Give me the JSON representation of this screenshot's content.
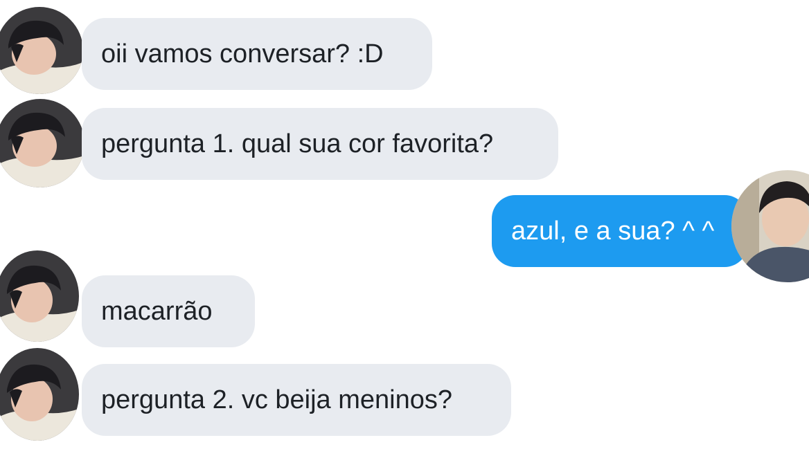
{
  "conversation": {
    "messages": [
      {
        "sender": "other",
        "text": "oii vamos conversar? :D"
      },
      {
        "sender": "other",
        "text": "pergunta 1. qual sua cor favorita?"
      },
      {
        "sender": "me",
        "text": "azul, e a sua? ^ ^"
      },
      {
        "sender": "other",
        "text": "macarrão"
      },
      {
        "sender": "other",
        "text": "pergunta 2. vc beija meninos?"
      }
    ]
  },
  "colors": {
    "incoming_bubble": "#e8ebf0",
    "outgoing_bubble": "#1d9bf0",
    "incoming_text": "#1d2126",
    "outgoing_text": "#ffffff"
  },
  "icons": {
    "contact_avatar": "contact-avatar-photo",
    "user_avatar": "user-avatar-photo"
  }
}
